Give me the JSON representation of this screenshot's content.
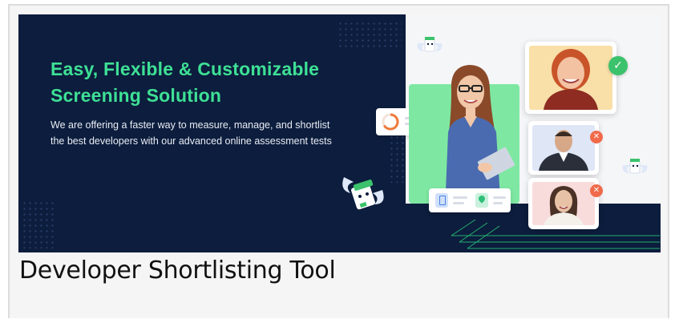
{
  "banner": {
    "headline_line1": "Easy, Flexible & Customizable",
    "headline_line2": "Screening Solution",
    "subtext": "We are offering a faster way to measure, manage, and shortlist the best developers with our advanced online assessment tests",
    "colors": {
      "navy": "#0c1d3d",
      "headline_green": "#3ee095",
      "panel_green": "#7ee8a2",
      "accept_green": "#3cc26c",
      "reject_orange": "#f06a4a"
    },
    "badges": {
      "accepted_icon": "checkmark-icon",
      "rejected_icon": "close-icon"
    }
  },
  "caption": {
    "title": "Developer Shortlisting Tool"
  }
}
